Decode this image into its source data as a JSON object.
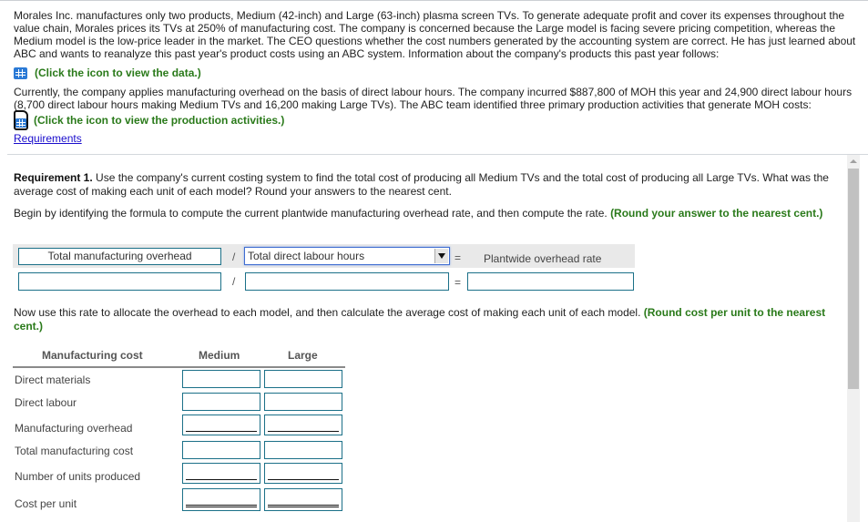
{
  "intro": {
    "paragraph1": "Morales Inc. manufactures only two products, Medium (42-inch) and Large (63-inch) plasma screen TVs. To generate adequate profit and cover its expenses throughout the value chain, Morales prices its TVs at 250% of manufacturing cost. The company is concerned because the Large model is facing severe pricing competition, whereas the Medium model is the low-price leader in the market. The CEO questions whether the cost numbers generated by the accounting system are correct. He has just learned about ABC and wants to reanalyze this past year's product costs using an ABC system. Information about the company's products this past year follows:",
    "data_link": "(Click the icon to view the data.)",
    "paragraph2": "Currently, the company applies manufacturing overhead on the basis of direct labour hours. The company incurred $887,800 of MOH this year and 24,900 direct labour hours (8,700 direct labour hours making Medium TVs and 16,200 making Large TVs). The ABC team identified three primary production activities that generate MOH costs:",
    "activities_link": "(Click the icon to view the production activities.)",
    "requirements_link": "Requirements"
  },
  "requirement": {
    "label": "Requirement 1.",
    "text": " Use the company's current costing system to find the total cost of producing all Medium TVs and the total cost of producing all Large TVs. What was the average cost of making each unit of each model? Round your answers to the nearest cent.",
    "begin_text": "Begin by identifying the formula to compute the current plantwide manufacturing overhead rate, and then compute the rate. ",
    "begin_hint": "(Round your answer to the nearest cent.)"
  },
  "formula": {
    "numerator_label": "Total manufacturing overhead",
    "divide": "/",
    "denominator_selected": "Total direct labour hours",
    "equals": "=",
    "result_label": "Plantwide overhead rate",
    "numerator_value": "",
    "denominator_value": "",
    "result_value": ""
  },
  "allocation": {
    "text": "Now use this rate to allocate the overhead to each model, and then calculate the average cost of making each unit of each model. ",
    "hint": "(Round cost per unit to the nearest cent.)"
  },
  "table": {
    "headers": [
      "Manufacturing cost",
      "Medium",
      "Large"
    ],
    "rows": [
      {
        "label": "Direct materials",
        "medium": "",
        "large": ""
      },
      {
        "label": "Direct labour",
        "medium": "",
        "large": ""
      },
      {
        "label": "Manufacturing overhead",
        "medium": "",
        "large": ""
      },
      {
        "label": "Total manufacturing cost",
        "medium": "",
        "large": ""
      },
      {
        "label": "Number of units produced",
        "medium": "",
        "large": ""
      },
      {
        "label": "Cost per unit",
        "medium": "",
        "large": ""
      }
    ]
  },
  "colors": {
    "hint_green": "#2a7a1a",
    "link_blue": "#1a0dcc",
    "input_border": "#1b7088",
    "icon_blue": "#2b7ad6"
  }
}
